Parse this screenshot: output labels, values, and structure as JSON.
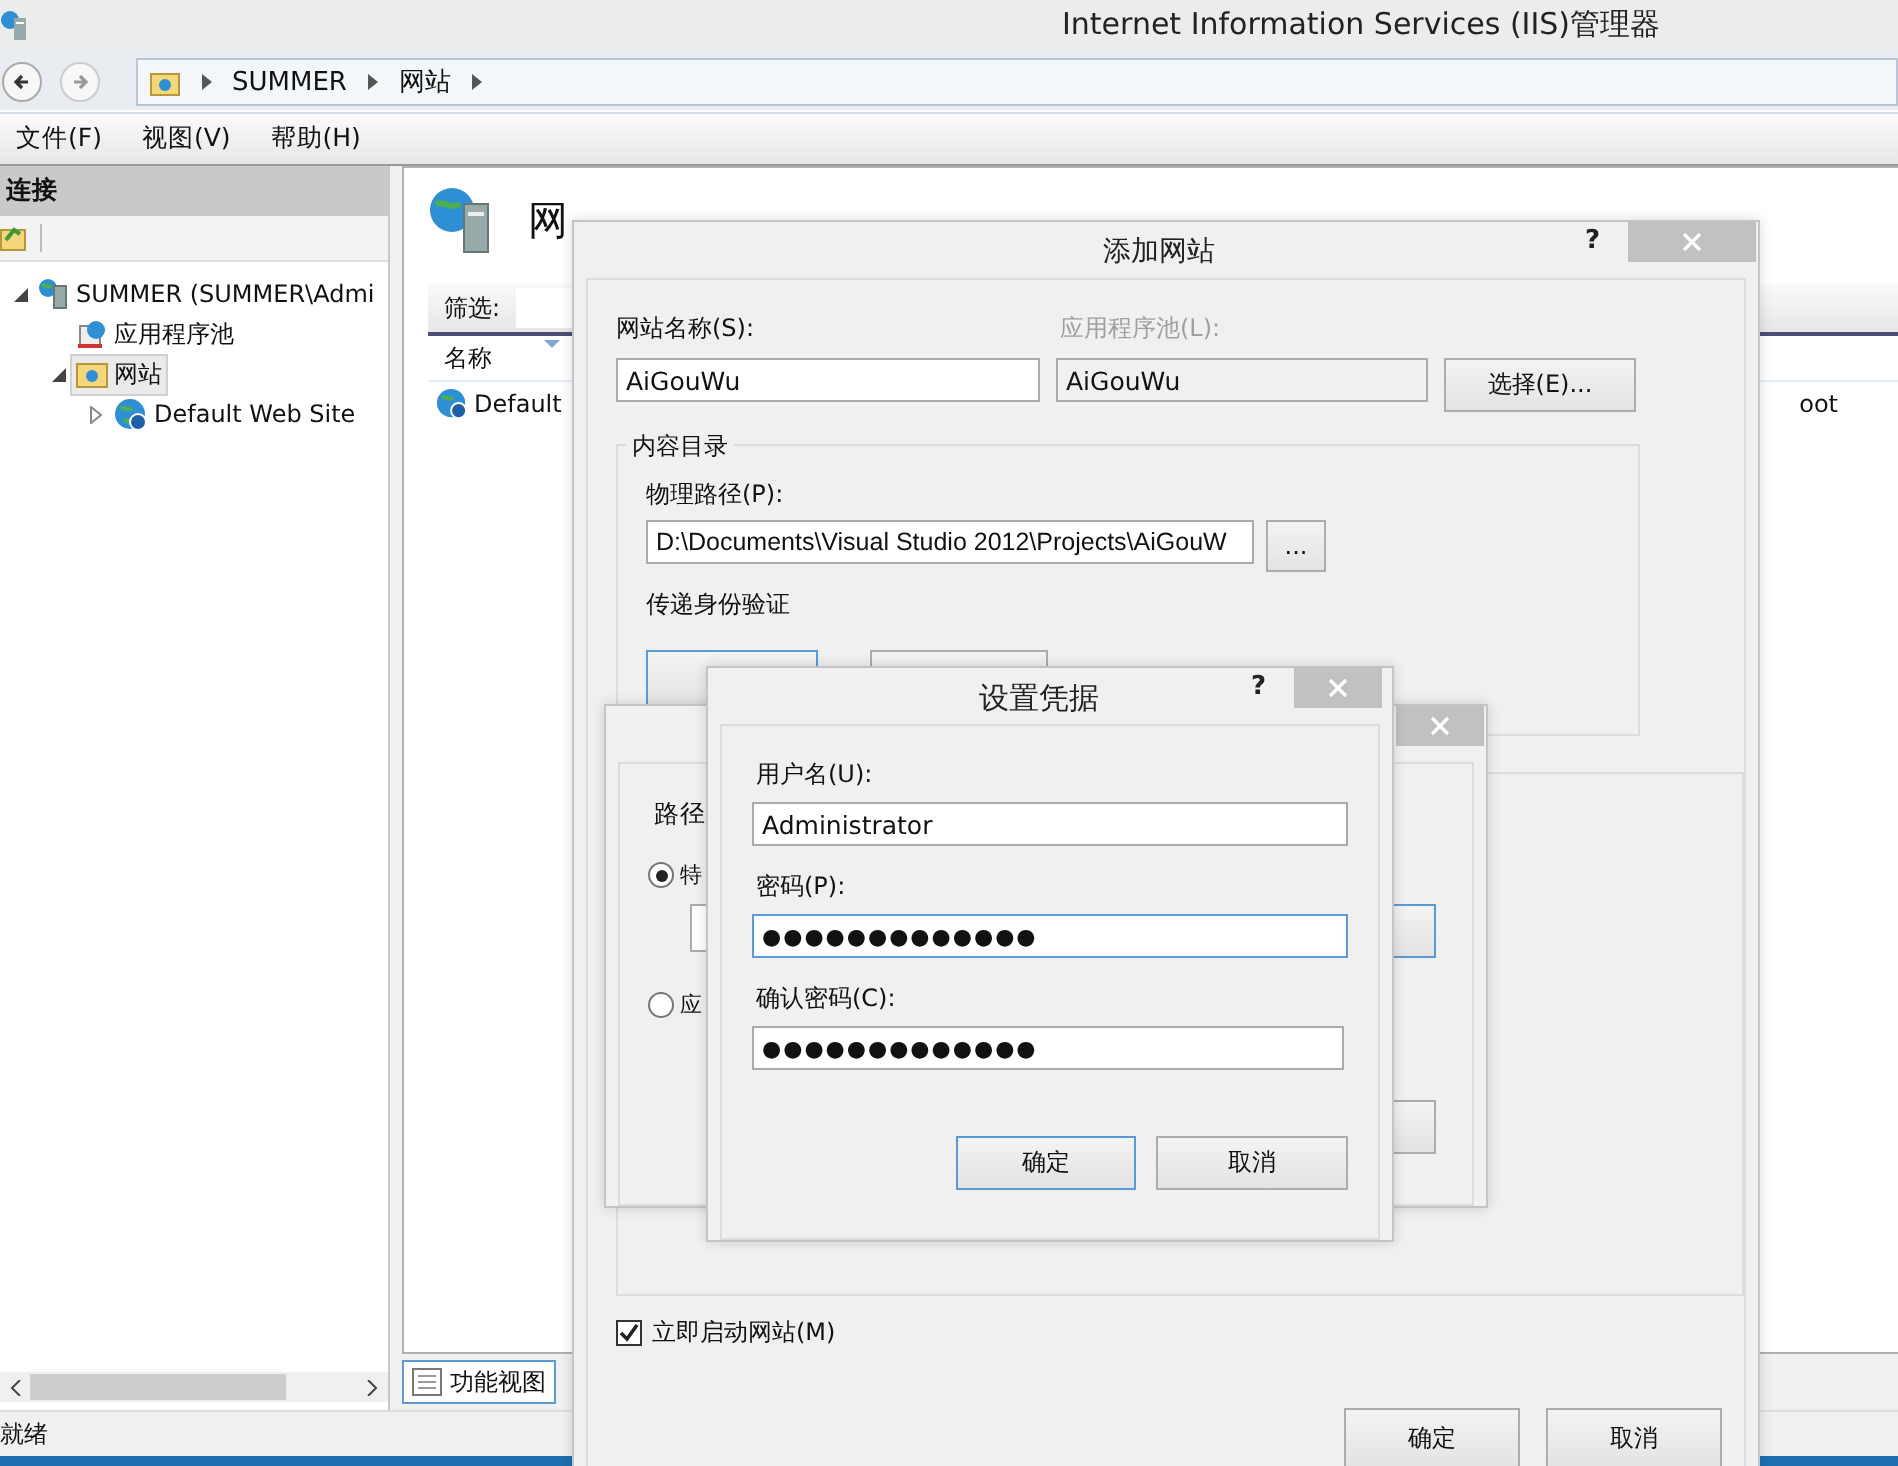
{
  "window": {
    "title": "Internet Information Services (IIS)管理器"
  },
  "address_bar": {
    "crumbs": [
      "SUMMER",
      "网站"
    ]
  },
  "menu": [
    "文件(F)",
    "视图(V)",
    "帮助(H)"
  ],
  "connections": {
    "title": "连接",
    "tree": [
      {
        "label": "SUMMER (SUMMER\\Admi",
        "kind": "server",
        "expanded": true,
        "selected": false,
        "children": [
          {
            "label": "应用程序池",
            "kind": "pool",
            "selected": false
          },
          {
            "label": "网站",
            "kind": "folder",
            "expanded": true,
            "selected": true,
            "children": [
              {
                "label": "Default Web Site",
                "kind": "site",
                "expanded": false,
                "selected": false
              }
            ]
          }
        ]
      }
    ]
  },
  "content": {
    "title": "网",
    "filter_label": "筛选:",
    "columns": [
      "名称"
    ],
    "rows": [
      {
        "name": "Default",
        "column_3": "oot"
      }
    ],
    "view_tabs": [
      {
        "label": "功能视图",
        "selected": true
      }
    ]
  },
  "status_bar": "就绪",
  "add_site_dialog": {
    "title": "添加网站",
    "help": "?",
    "site_name_label": "网站名称(S):",
    "site_name": "AiGouWu",
    "pool_label": "应用程序池(L):",
    "pool": "AiGouWu",
    "select_button": "选择(E)...",
    "content_group": "内容目录",
    "path_label": "物理路径(P):",
    "path": "D:\\Documents\\Visual Studio 2012\\Projects\\AiGouW",
    "browse_button": "...",
    "auth_label": "传递身份验证",
    "start_label": "立即启动网站(M)",
    "start_checked": true,
    "ok": "确定",
    "cancel": "取消"
  },
  "connect_as_dialog": {
    "label": "路径",
    "options": [
      {
        "label": "特",
        "selected": true
      },
      {
        "label": "应",
        "selected": false
      }
    ]
  },
  "credentials_dialog": {
    "title": "设置凭据",
    "help": "?",
    "user_label": "用户名(U):",
    "user": "Administrator",
    "password_label": "密码(P):",
    "password": "●●●●●●●●●●●●●",
    "confirm_label": "确认密码(C):",
    "confirm": "●●●●●●●●●●●●●",
    "ok": "确定",
    "cancel": "取消"
  }
}
